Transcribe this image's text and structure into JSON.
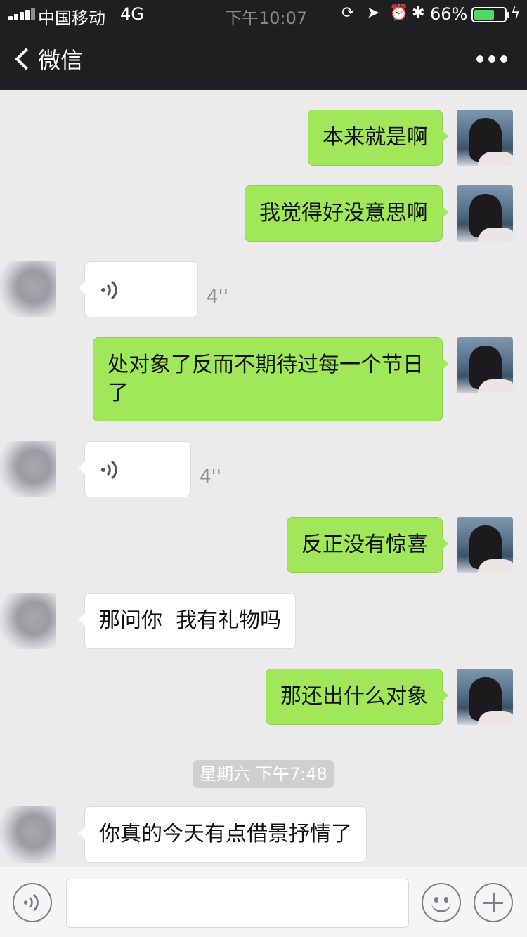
{
  "status_bar": {
    "carrier": "中国移动",
    "network": "4G",
    "time": "下午10:07",
    "battery_percent": "66%",
    "battery_level": 0.66,
    "icons": [
      "signal-icon",
      "orientation-lock-icon",
      "location-icon",
      "alarm-icon",
      "bluetooth-icon",
      "battery-icon",
      "charging-icon"
    ]
  },
  "nav": {
    "back_label": "微信",
    "more_icon": "more-dots-icon"
  },
  "messages": [
    {
      "side": "me",
      "type": "text",
      "text": "本来就是啊"
    },
    {
      "side": "me",
      "type": "text",
      "text": "我觉得好没意思啊"
    },
    {
      "side": "other",
      "type": "voice",
      "duration": "4''"
    },
    {
      "side": "me",
      "type": "text",
      "text": "处对象了反而不期待过每一个节日了"
    },
    {
      "side": "other",
      "type": "voice",
      "duration": "4''"
    },
    {
      "side": "me",
      "type": "text",
      "text": "反正没有惊喜"
    },
    {
      "side": "other",
      "type": "text",
      "text": "那问你  我有礼物吗"
    },
    {
      "side": "me",
      "type": "text",
      "text": "那还出什么对象"
    },
    {
      "side": "other",
      "type": "text",
      "text": "你真的今天有点借景抒情了"
    }
  ],
  "timestamp": "星期六 下午7:48",
  "input_bar": {
    "voice_icon": "voice-input-icon",
    "emoji_icon": "emoji-icon",
    "plus_icon": "plus-icon",
    "text_value": ""
  },
  "colors": {
    "my_bubble": "#a0e75a",
    "other_bubble": "#ffffff",
    "background": "#ebebeb",
    "header": "#1f1f22"
  }
}
